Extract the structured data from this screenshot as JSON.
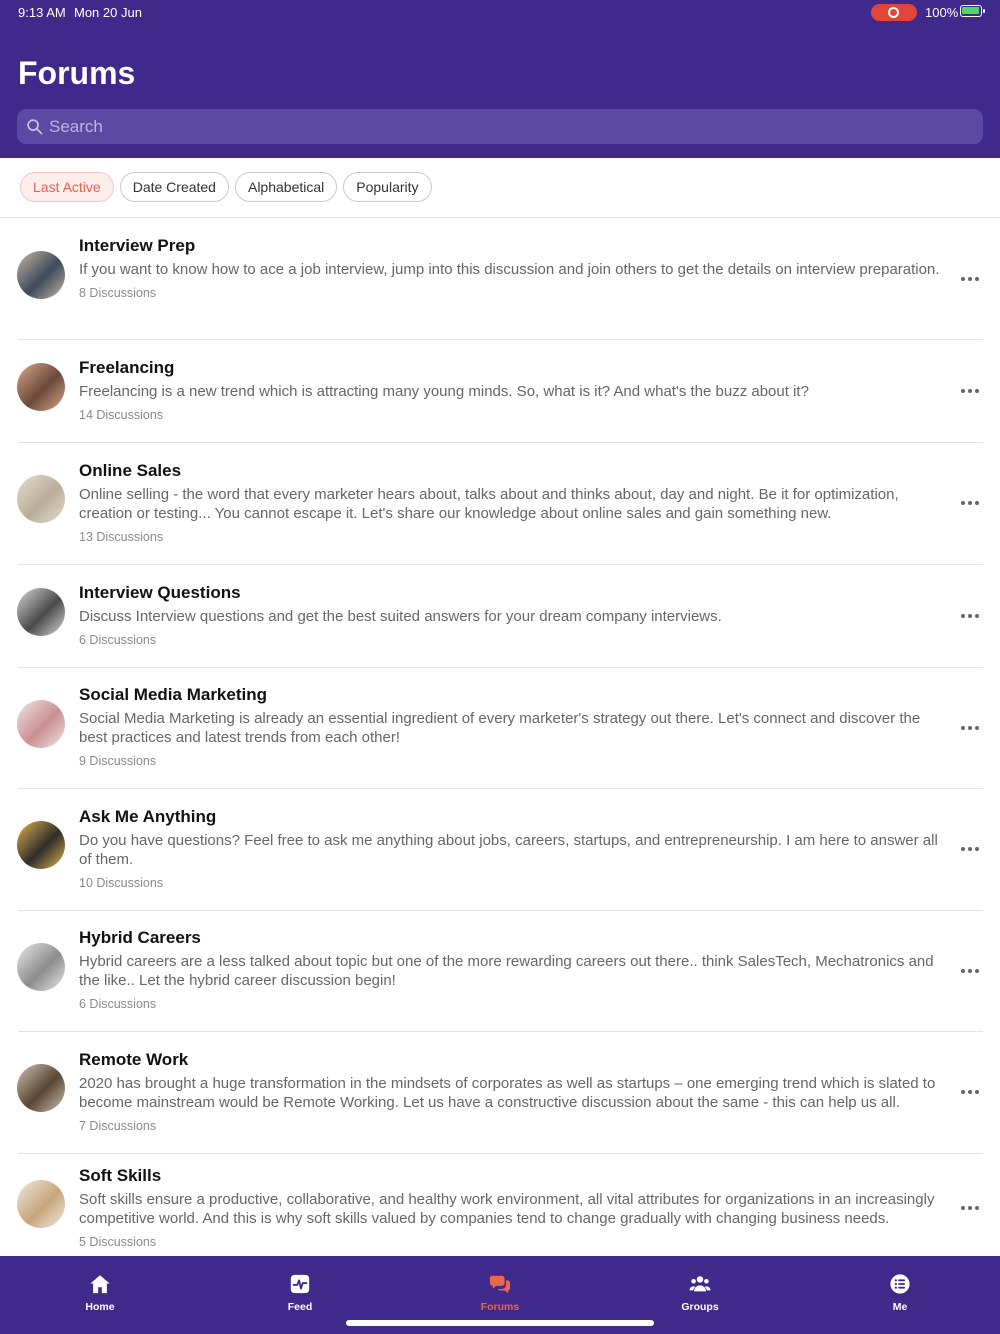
{
  "status_bar": {
    "time": "9:13 AM",
    "date": "Mon 20 Jun",
    "battery": "100%"
  },
  "header": {
    "title": "Forums",
    "search_placeholder": "Search"
  },
  "filters": [
    {
      "label": "Last Active",
      "active": true
    },
    {
      "label": "Date Created",
      "active": false
    },
    {
      "label": "Alphabetical",
      "active": false
    },
    {
      "label": "Popularity",
      "active": false
    }
  ],
  "forums": [
    {
      "title": "Interview Prep",
      "description": "If you want to know how to ace a job interview, jump into this discussion and join others to get the details on interview preparation.",
      "count": "8 Discussions",
      "avatar_colors": [
        "#3c4a5c",
        "#c9b7a0"
      ]
    },
    {
      "title": "Freelancing",
      "description": "Freelancing is a new trend which is attracting many young minds. So, what is it? And what's the buzz about it?",
      "count": "14 Discussions",
      "avatar_colors": [
        "#6b4a3a",
        "#d7a98a"
      ]
    },
    {
      "title": "Online Sales",
      "description": "Online selling - the word that every marketer hears about, talks about and thinks about, day and night. Be it for optimization, creation or testing... You cannot escape it. Let's share our knowledge about online sales and gain something new.",
      "count": "13 Discussions",
      "avatar_colors": [
        "#b8ad98",
        "#e4ddd0"
      ]
    },
    {
      "title": "Interview Questions",
      "description": "Discuss Interview questions and get the best suited answers for your dream company interviews.",
      "count": "6 Discussions",
      "avatar_colors": [
        "#4a4a4a",
        "#d8d8d8"
      ]
    },
    {
      "title": "Social Media Marketing",
      "description": "Social Media Marketing is already an essential ingredient of every marketer's strategy out there. Let's connect and discover the best practices and latest trends from each other!",
      "count": "9 Discussions",
      "avatar_colors": [
        "#c98f8f",
        "#f1e6e6"
      ]
    },
    {
      "title": "Ask Me Anything",
      "description": "Do you have questions? Feel free to ask me anything about jobs, careers, startups, and entrepreneurship. I am here to answer all of them.",
      "count": "10 Discussions",
      "avatar_colors": [
        "#2e2e2e",
        "#e2b54a"
      ]
    },
    {
      "title": "Hybrid Careers",
      "description": "Hybrid careers are a less talked about topic but one of the more rewarding careers out there.. think SalesTech, Mechatronics and the like.. Let the hybrid career discussion begin!",
      "count": "6 Discussions",
      "avatar_colors": [
        "#8c8c8c",
        "#e9e9e9"
      ]
    },
    {
      "title": "Remote Work",
      "description": "2020 has brought a huge transformation in the mindsets of corporates as well as startups – one emerging trend which is slated to become mainstream would be Remote Working. Let us have a constructive discussion about the same - this can help us all.",
      "count": "7 Discussions",
      "avatar_colors": [
        "#5a4634",
        "#cfc2b2"
      ]
    },
    {
      "title": "Soft Skills",
      "description": "Soft skills ensure a productive, collaborative, and healthy work environment, all vital attributes for organizations in an increasingly competitive world. And this is why soft skills valued by companies tend to change gradually with changing business needs.",
      "count": "5 Discussions",
      "avatar_colors": [
        "#c7a57a",
        "#eeeae4"
      ]
    }
  ],
  "tabs": [
    {
      "label": "Home",
      "icon": "home-icon",
      "active": false
    },
    {
      "label": "Feed",
      "icon": "feed-icon",
      "active": false
    },
    {
      "label": "Forums",
      "icon": "forums-icon",
      "active": true
    },
    {
      "label": "Groups",
      "icon": "groups-icon",
      "active": false
    },
    {
      "label": "Me",
      "icon": "me-icon",
      "active": false
    }
  ],
  "colors": {
    "brand": "#3f2a8c",
    "accent": "#e9674d"
  }
}
